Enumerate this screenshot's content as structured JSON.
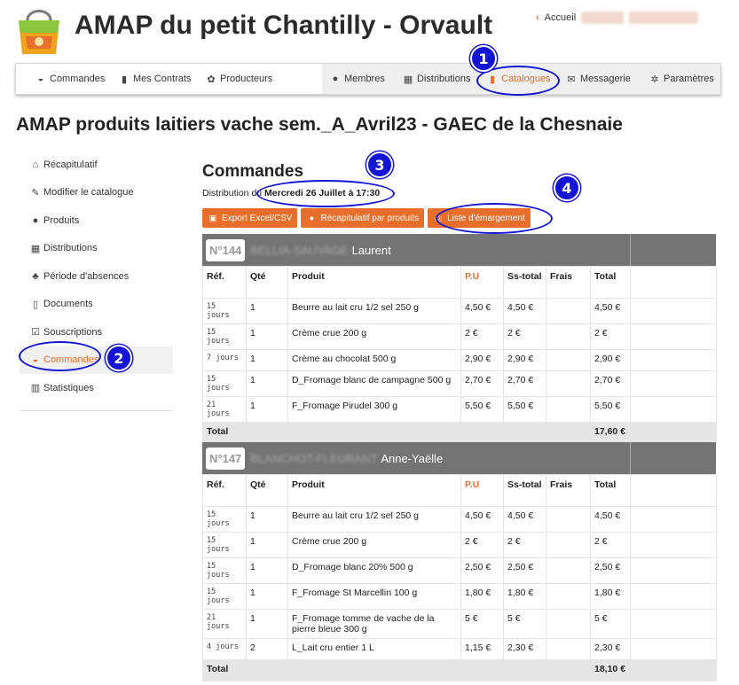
{
  "header": {
    "title": "AMAP du petit Chantilly - Orvault",
    "accueil_label": "Accueil"
  },
  "nav": {
    "items": [
      {
        "label": "Commandes",
        "icon": "basket-icon"
      },
      {
        "label": "Mes Contrats",
        "icon": "book-icon"
      },
      {
        "label": "Producteurs",
        "icon": "seedling-icon"
      },
      {
        "label": "Membres",
        "icon": "users-icon"
      },
      {
        "label": "Distributions",
        "icon": "calendar-icon"
      },
      {
        "label": "Catalogues",
        "icon": "book-icon"
      },
      {
        "label": "Messagerie",
        "icon": "envelope-icon"
      },
      {
        "label": "Paramètres",
        "icon": "gear-icon"
      }
    ]
  },
  "contract_title": "AMAP produits laitiers vache sem._A_Avril23 - GAEC de la Chesnaie",
  "sidebar": {
    "items": [
      {
        "label": "Récapitulatif",
        "icon": "home-icon"
      },
      {
        "label": "Modifier le catalogue",
        "icon": "edit-icon"
      },
      {
        "label": "Produits",
        "icon": "produce-icon"
      },
      {
        "label": "Distributions",
        "icon": "calendar-icon"
      },
      {
        "label": "Période d'absences",
        "icon": "palm-icon"
      },
      {
        "label": "Documents",
        "icon": "file-icon"
      },
      {
        "label": "Souscriptions",
        "icon": "check-icon"
      },
      {
        "label": "Commandes",
        "icon": "basket-icon"
      },
      {
        "label": "Statistiques",
        "icon": "chart-icon"
      }
    ]
  },
  "main": {
    "title": "Commandes",
    "distribution_prefix": "Distribution du",
    "distribution_date": "Mercredi 26 Juillet à 17:30",
    "buttons": {
      "export": "Export Excel/CSV",
      "recap": "Récapitulatif par produits",
      "emargement": "Liste d'émargement"
    }
  },
  "table_headers": {
    "ref": "Réf.",
    "qty": "Qté",
    "product": "Produit",
    "pu": "P.U",
    "subtotal": "Ss-total",
    "fees": "Frais",
    "total": "Total"
  },
  "orders": [
    {
      "number": "N°144",
      "lastname": "BELLIA-SAUVAGE",
      "firstname": "Laurent",
      "rows": [
        {
          "ref": "15 jours",
          "qty": "1",
          "product": "Beurre au lait cru 1/2 sel 250 g",
          "pu": "4,50 €",
          "subtotal": "4,50 €",
          "fees": "",
          "total": "4,50 €"
        },
        {
          "ref": "15 jours",
          "qty": "1",
          "product": "Crème crue 200 g",
          "pu": "2 €",
          "subtotal": "2 €",
          "fees": "",
          "total": "2 €"
        },
        {
          "ref": "7 jours",
          "qty": "1",
          "product": "Crème au chocolat 500 g",
          "pu": "2,90 €",
          "subtotal": "2,90 €",
          "fees": "",
          "total": "2,90 €"
        },
        {
          "ref": "15 jours",
          "qty": "1",
          "product": "D_Fromage blanc de campagne 500 g",
          "pu": "2,70 €",
          "subtotal": "2,70 €",
          "fees": "",
          "total": "2,70 €"
        },
        {
          "ref": "21 jours",
          "qty": "1",
          "product": "F_Fromage Pirudel 300 g",
          "pu": "5,50 €",
          "subtotal": "5,50 €",
          "fees": "",
          "total": "5,50 €"
        }
      ],
      "total_label": "Total",
      "total": "17,60 €"
    },
    {
      "number": "N°147",
      "lastname": "BLANCHOT-FLEURANT",
      "firstname": "Anne-Yaëlle",
      "rows": [
        {
          "ref": "15 jours",
          "qty": "1",
          "product": "Beurre au lait cru 1/2 sel 250 g",
          "pu": "4,50 €",
          "subtotal": "4,50 €",
          "fees": "",
          "total": "4,50 €"
        },
        {
          "ref": "15 jours",
          "qty": "1",
          "product": "Crème crue 200 g",
          "pu": "2 €",
          "subtotal": "2 €",
          "fees": "",
          "total": "2 €"
        },
        {
          "ref": "15 jours",
          "qty": "1",
          "product": "D_Fromage blanc 20% 500 g",
          "pu": "2,50 €",
          "subtotal": "2,50 €",
          "fees": "",
          "total": "2,50 €"
        },
        {
          "ref": "15 jours",
          "qty": "1",
          "product": "F_Fromage St Marcellin 100 g",
          "pu": "1,80 €",
          "subtotal": "1,80 €",
          "fees": "",
          "total": "1,80 €"
        },
        {
          "ref": "21 jours",
          "qty": "1",
          "product": "F_Fromage tomme de vache de la pierre bleue 300 g",
          "pu": "5 €",
          "subtotal": "5 €",
          "fees": "",
          "total": "5 €"
        },
        {
          "ref": "4 jours",
          "qty": "2",
          "product": "L_Lait cru entier 1 L",
          "pu": "1,15 €",
          "subtotal": "2,30 €",
          "fees": "",
          "total": "2,30 €"
        }
      ],
      "total_label": "Total",
      "total": "18,10 €"
    }
  ],
  "annotations": [
    "1",
    "2",
    "3",
    "4"
  ],
  "colors": {
    "accent": "#e86e2c",
    "annotation": "#1414d4",
    "order_header": "#747474"
  }
}
